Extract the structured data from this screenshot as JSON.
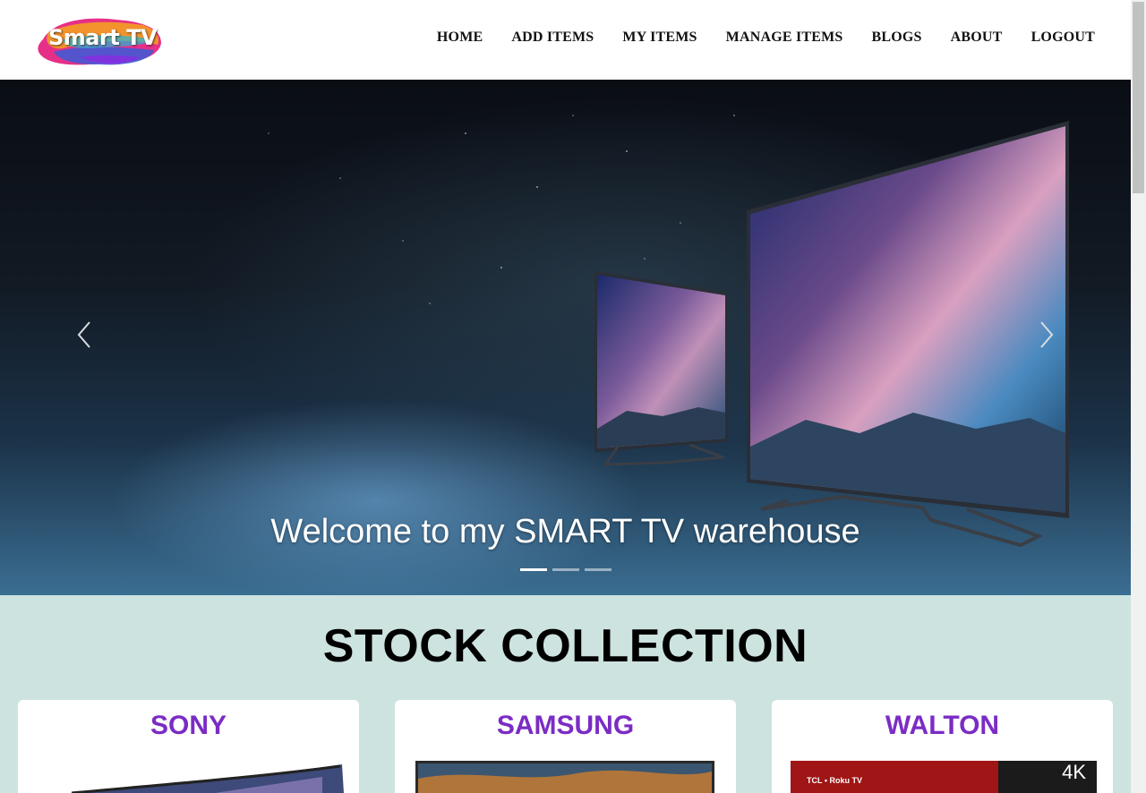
{
  "brand": {
    "logo_text": "Smart TV"
  },
  "nav": {
    "items": [
      {
        "label": "HOME"
      },
      {
        "label": "ADD ITEMS"
      },
      {
        "label": "MY ITEMS"
      },
      {
        "label": "MANAGE ITEMS"
      },
      {
        "label": "BLOGS"
      },
      {
        "label": "ABOUT"
      },
      {
        "label": "LOGOUT"
      }
    ]
  },
  "hero": {
    "caption": "Welcome to my SMART TV warehouse",
    "slide_count": 3,
    "active_slide": 1,
    "prev_icon": "chevron-left-icon",
    "next_icon": "chevron-right-icon"
  },
  "stock": {
    "title": "STOCK COLLECTION",
    "cards": [
      {
        "brand": "SONY"
      },
      {
        "brand": "SAMSUNG"
      },
      {
        "brand": "WALTON",
        "image_badge": "4K",
        "image_label": "TCL • Roku TV"
      }
    ]
  },
  "colors": {
    "section_bg": "#cde3df",
    "brand_accent": "#7b2cc4",
    "nav_text": "#111111"
  }
}
